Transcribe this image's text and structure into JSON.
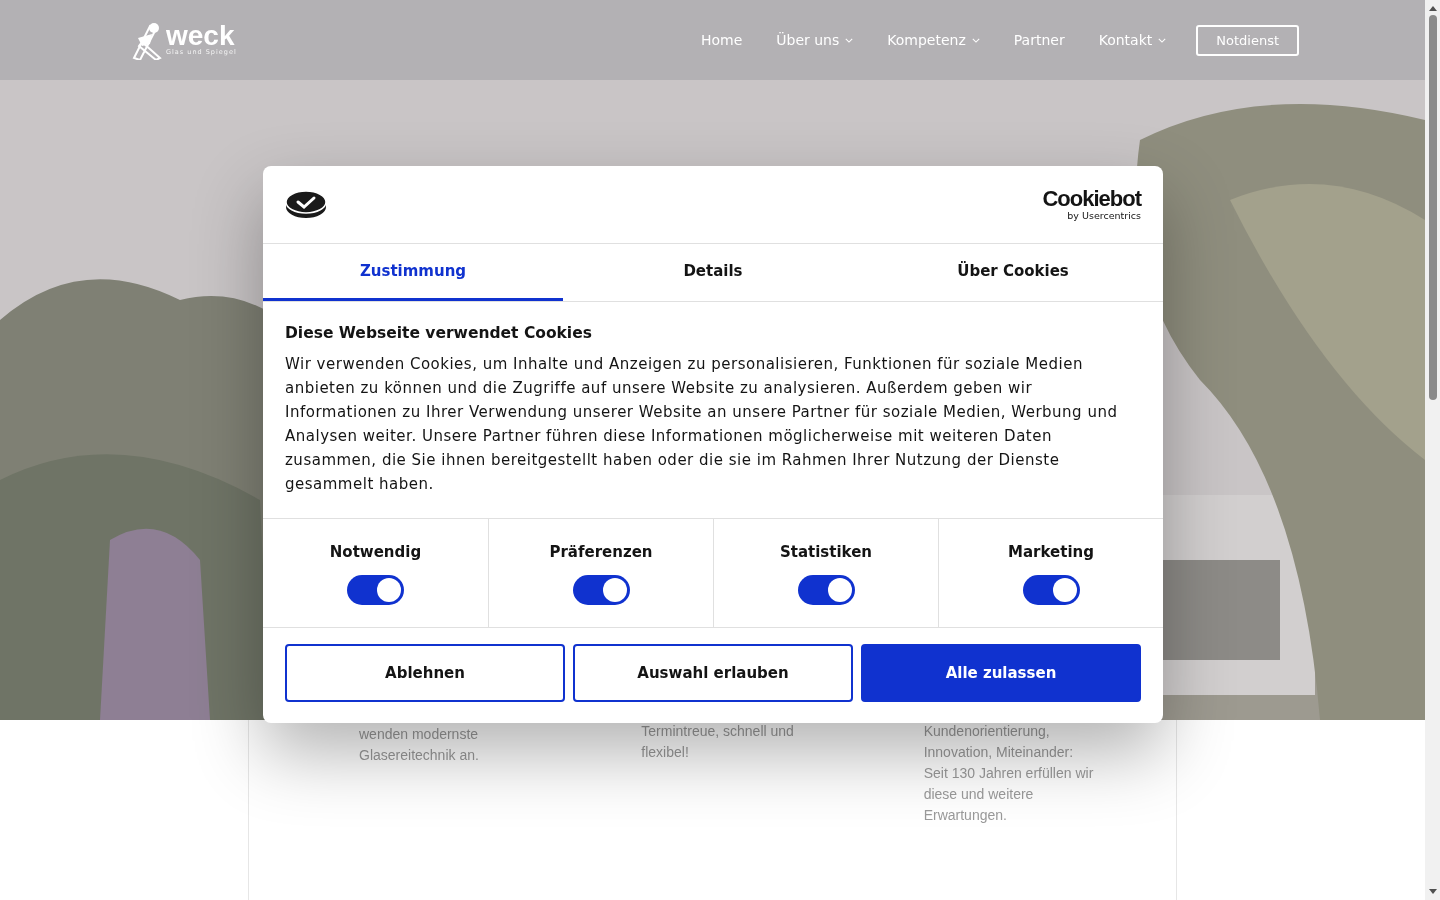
{
  "header": {
    "logo": {
      "name": "weck",
      "tagline": "Glas und Spiegel"
    },
    "nav": [
      {
        "label": "Home",
        "has_menu": false
      },
      {
        "label": "Über uns",
        "has_menu": true
      },
      {
        "label": "Kompetenz",
        "has_menu": true
      },
      {
        "label": "Partner",
        "has_menu": false
      },
      {
        "label": "Kontakt",
        "has_menu": true
      }
    ],
    "cta": "Notdienst"
  },
  "features": [
    {
      "text": "wenden modernste Glasereitechnik an."
    },
    {
      "text": "Termintreue, schnell und flexibel!"
    },
    {
      "text": "Kundenorientierung, Innovation, Miteinander: Seit 130 Jahren erfüllen wir diese und weitere Erwartungen."
    }
  ],
  "cookie_dialog": {
    "brand": {
      "name": "Cookiebot",
      "byline": "by Usercentrics"
    },
    "tabs": [
      {
        "label": "Zustimmung",
        "selected": true
      },
      {
        "label": "Details",
        "selected": false
      },
      {
        "label": "Über Cookies",
        "selected": false
      }
    ],
    "heading": "Diese Webseite verwendet Cookies",
    "body": "Wir verwenden Cookies, um Inhalte und Anzeigen zu personalisieren, Funktionen für soziale Medien anbieten zu können und die Zugriffe auf unsere Website zu analysieren. Außerdem geben wir Informationen zu Ihrer Verwendung unserer Website an unsere Partner für soziale Medien, Werbung und Analysen weiter. Unsere Partner führen diese Informationen möglicherweise mit weiteren Daten zusammen, die Sie ihnen bereitgestellt haben oder die sie im Rahmen Ihrer Nutzung der Dienste gesammelt haben.",
    "categories": [
      {
        "label": "Notwendig",
        "checked": true
      },
      {
        "label": "Präferenzen",
        "checked": true
      },
      {
        "label": "Statistiken",
        "checked": true
      },
      {
        "label": "Marketing",
        "checked": true
      }
    ],
    "buttons": [
      {
        "label": "Ablehnen",
        "kind": "outline"
      },
      {
        "label": "Auswahl erlauben",
        "kind": "outline"
      },
      {
        "label": "Alle zulassen",
        "kind": "primary"
      }
    ]
  }
}
